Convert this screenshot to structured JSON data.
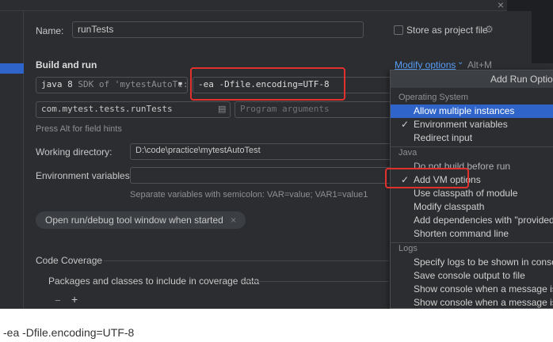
{
  "dialog": {
    "close_glyph": "×",
    "name_label": "Name:",
    "name_value": "runTests",
    "store_label": "Store as project file",
    "build_run_title": "Build and run",
    "modify_options_label": "Modify options",
    "modify_shortcut": "Alt+M",
    "jdk_value": "java 8",
    "jdk_sdk": "SDK of 'mytestAutoTe:",
    "vm_options_value": "-ea -Dfile.encoding=UTF-8",
    "main_class_value": "com.mytest.tests.runTests",
    "program_args_placeholder": "Program arguments",
    "field_hints": "Press Alt for field hints",
    "workdir_label": "Working directory:",
    "workdir_value": "D:\\code\\practice\\mytestAutoTest",
    "env_label": "Environment variables:",
    "env_hint": "Separate variables with semicolon: VAR=value; VAR1=value1",
    "chip_label": "Open run/debug tool window when started",
    "chip_close": "×",
    "coverage_title": "Code Coverage",
    "packages_label": "Packages and classes to include in coverage data",
    "minus": "−",
    "plus": "+"
  },
  "popup": {
    "title": "Add Run Option",
    "groups": {
      "os": "Operating System",
      "java": "Java",
      "logs": "Logs"
    },
    "os_items": [
      {
        "label": "Allow multiple instances",
        "checked": false,
        "selected": true
      },
      {
        "label": "Environment variables",
        "checked": true,
        "selected": false
      },
      {
        "label": "Redirect input",
        "checked": false,
        "selected": false
      }
    ],
    "java_items": [
      {
        "label": "Do not build before run",
        "checked": false
      },
      {
        "label": "Add VM options",
        "checked": true
      },
      {
        "label": "Use classpath of module",
        "checked": false
      },
      {
        "label": "Modify classpath",
        "checked": false
      },
      {
        "label": "Add dependencies with \"provided\" s",
        "checked": false
      },
      {
        "label": "Shorten command line",
        "checked": false
      }
    ],
    "logs_items": [
      {
        "label": "Specify logs to be shown in console",
        "checked": false
      },
      {
        "label": "Save console output to file",
        "checked": false
      },
      {
        "label": "Show console when a message is pri",
        "checked": false
      },
      {
        "label": "Show console when a message is pri",
        "checked": false
      }
    ],
    "check_glyph": "✓"
  },
  "caption": "-ea -Dfile.encoding=UTF-8",
  "colors": {
    "background": "#2b2d30",
    "selection": "#2f65ca",
    "link": "#589df6",
    "highlight_box": "#e0312d"
  }
}
